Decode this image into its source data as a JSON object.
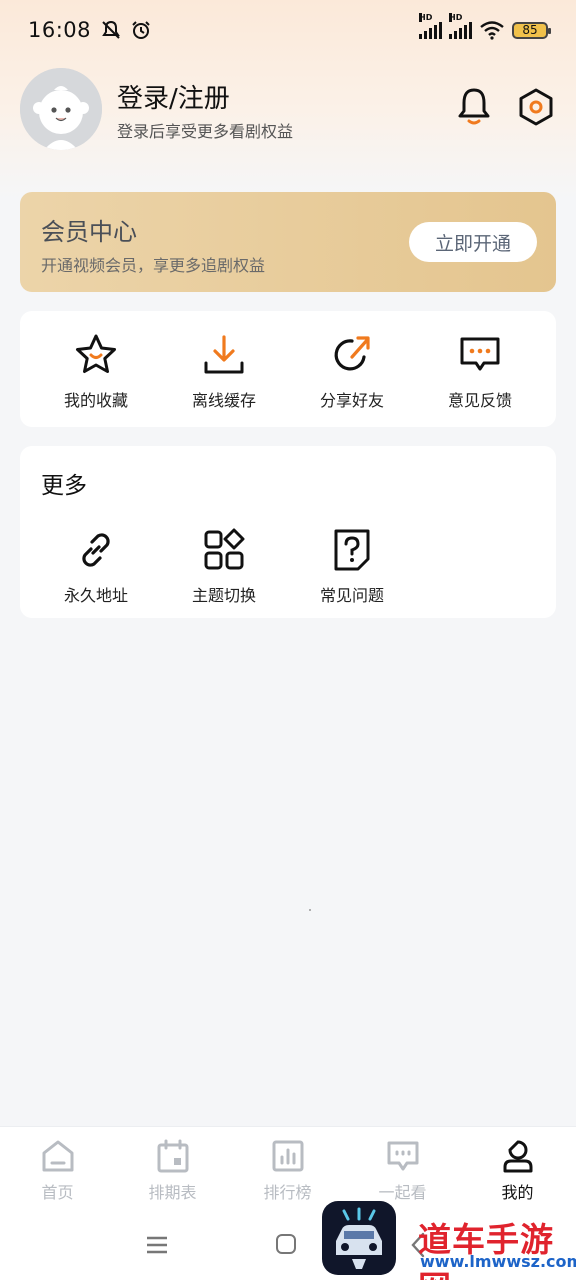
{
  "status_bar": {
    "time": "16:08",
    "network_1": "HD",
    "network_2": "HD",
    "battery": "85"
  },
  "profile": {
    "title": "登录/注册",
    "subtitle": "登录后享受更多看剧权益"
  },
  "vip": {
    "title": "会员中心",
    "subtitle": "开通视频会员，享更多追剧权益",
    "button": "立即开通"
  },
  "quick_actions": [
    {
      "label": "我的收藏",
      "icon": "star-icon"
    },
    {
      "label": "离线缓存",
      "icon": "download-icon"
    },
    {
      "label": "分享好友",
      "icon": "share-icon"
    },
    {
      "label": "意见反馈",
      "icon": "feedback-icon"
    }
  ],
  "more": {
    "title": "更多",
    "items": [
      {
        "label": "永久地址",
        "icon": "link-icon"
      },
      {
        "label": "主题切换",
        "icon": "theme-icon"
      },
      {
        "label": "常见问题",
        "icon": "faq-icon"
      }
    ]
  },
  "tabbar": [
    {
      "label": "首页",
      "icon": "home-icon",
      "active": false
    },
    {
      "label": "排期表",
      "icon": "calendar-icon",
      "active": false
    },
    {
      "label": "排行榜",
      "icon": "ranking-icon",
      "active": false
    },
    {
      "label": "一起看",
      "icon": "chat-icon",
      "active": false
    },
    {
      "label": "我的",
      "icon": "user-icon",
      "active": true
    }
  ],
  "watermark": {
    "title": "道车手游网",
    "url": "www.lmwwsz.com"
  },
  "colors": {
    "accent": "#f07a1e",
    "vip_gold": "#e6c792",
    "background": "#f5f6f8"
  }
}
